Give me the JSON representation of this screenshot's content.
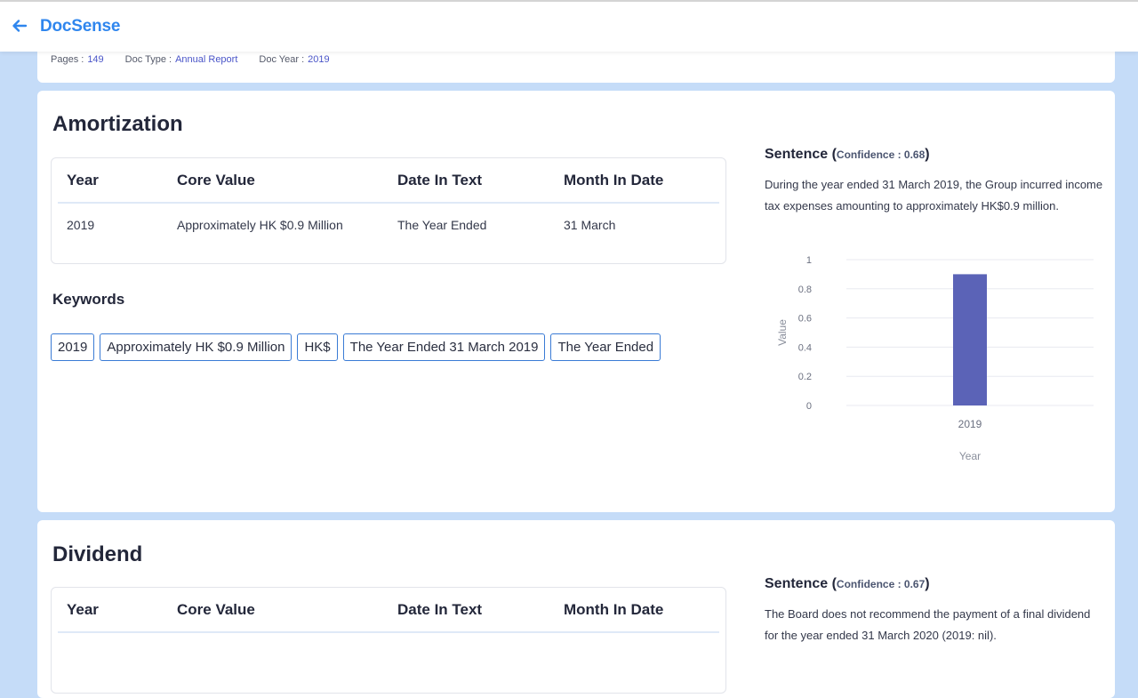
{
  "app": {
    "brand": "DocSense"
  },
  "meta": {
    "pages_label": "Pages :",
    "pages_value": "149",
    "doctype_label": "Doc Type :",
    "doctype_value": "Annual Report",
    "docyear_label": "Doc Year :",
    "docyear_value": "2019"
  },
  "sections": [
    {
      "title": "Amortization",
      "table": {
        "headers": [
          "Year",
          "Core Value",
          "Date In Text",
          "Month In Date"
        ],
        "rows": [
          [
            "2019",
            "Approximately HK $0.9 Million",
            "The Year Ended",
            "31 March"
          ]
        ]
      },
      "keywords_title": "Keywords",
      "keywords": [
        "2019",
        "Approximately HK $0.9 Million",
        "HK$",
        "The Year Ended 31 March 2019",
        "The Year Ended"
      ],
      "sentence_label": "Sentence (",
      "confidence": "Confidence : 0.68",
      "sentence_close": ")",
      "sentence": "During the year ended 31 March 2019, the Group incurred income tax expenses amounting to approximately HK$0.9 million."
    },
    {
      "title": "Dividend",
      "table": {
        "headers": [
          "Year",
          "Core Value",
          "Date In Text",
          "Month In Date"
        ]
      },
      "sentence_label": "Sentence (",
      "confidence": "Confidence : 0.67",
      "sentence_close": ")",
      "sentence": "The Board does not recommend the payment of a final dividend for the year ended 31 March 2020 (2019: nil)."
    }
  ],
  "chart_data": {
    "type": "bar",
    "categories": [
      "2019"
    ],
    "values": [
      0.9
    ],
    "xlabel": "Year",
    "ylabel": "Value",
    "ylim": [
      0,
      1
    ],
    "yticks": [
      "1",
      "0.8",
      "0.6",
      "0.4",
      "0.2",
      "0"
    ],
    "grid": true,
    "color": "#5b63b7"
  },
  "colors": {
    "accent": "#2f86ee",
    "link": "#4a55c8",
    "bar": "#5b63b7",
    "background": "#c5dcf8"
  }
}
